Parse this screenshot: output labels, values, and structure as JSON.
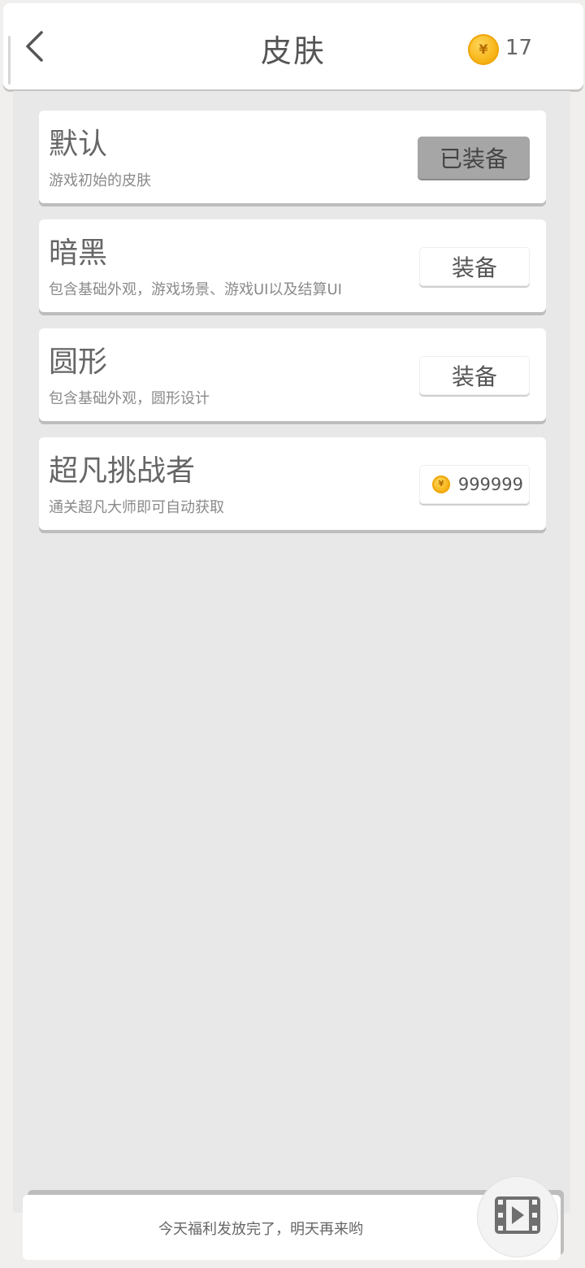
{
  "header": {
    "title": "皮肤",
    "coin_symbol": "¥",
    "coin_count": "17"
  },
  "skins": [
    {
      "title": "默认",
      "desc": "游戏初始的皮肤",
      "button": "已装备",
      "state": "equipped"
    },
    {
      "title": "暗黑",
      "desc": "包含基础外观，游戏场景、游戏UI以及结算UI",
      "button": "装备",
      "state": "available"
    },
    {
      "title": "圆形",
      "desc": "包含基础外观，圆形设计",
      "button": "装备",
      "state": "available"
    },
    {
      "title": "超凡挑战者",
      "desc": "通关超凡大师即可自动获取",
      "coin_symbol": "¥",
      "price": "999999",
      "state": "locked"
    }
  ],
  "footer": {
    "message": "今天福利发放完了，明天再来哟"
  },
  "colors": {
    "background": "#f1efee",
    "panel": "#e8e8e8",
    "equipped_button": "#a6a6a6",
    "coin": "#f7b417"
  }
}
